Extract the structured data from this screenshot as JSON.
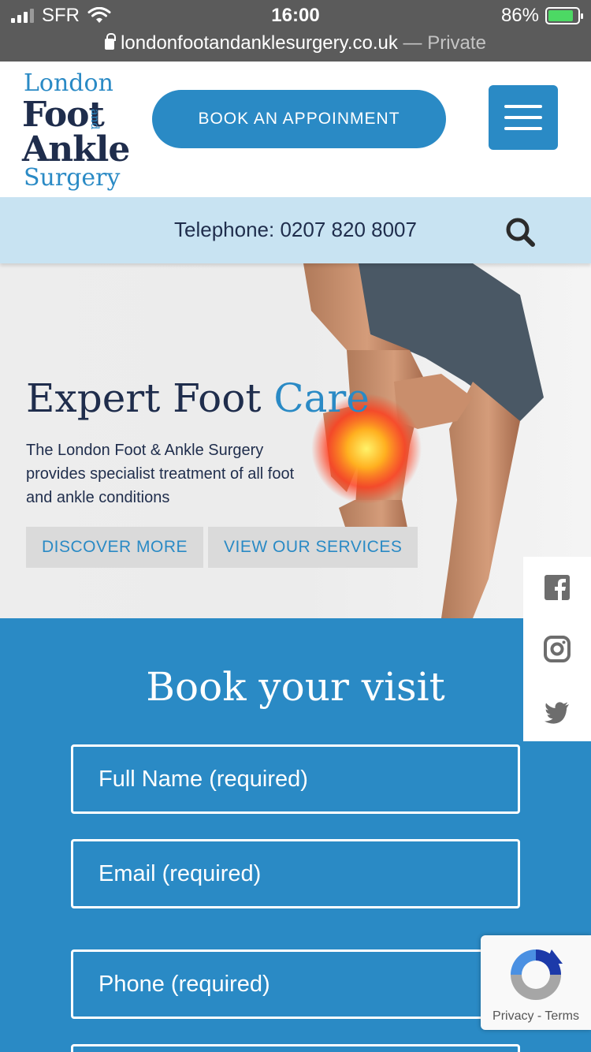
{
  "status_bar": {
    "carrier": "SFR",
    "time": "16:00",
    "battery_percent": "86%",
    "battery_level": 0.86,
    "battery_color": "#4cd964"
  },
  "url_bar": {
    "url": "londonfootandanklesurgery.co.uk",
    "mode": "— Private"
  },
  "logo": {
    "line1": "London",
    "line2": "Foot",
    "and": "and",
    "line3": "Ankle",
    "line4": "Surgery"
  },
  "header": {
    "book_label": "BOOK AN APPOINMENT",
    "menu_icon": "hamburger-icon"
  },
  "phone_bar": {
    "text": "Telephone: 0207 820 8007",
    "search_icon": "search-icon"
  },
  "hero": {
    "title_main": "Expert Foot ",
    "title_accent": "Care",
    "description": "The London Foot & Ankle Surgery provides specialist treatment of all foot and ankle conditions",
    "btn_discover": "DISCOVER MORE",
    "btn_services": "VIEW OUR SERVICES"
  },
  "booking": {
    "title": "Book your visit",
    "fields": {
      "full_name": "Full Name  (required)",
      "email": "Email (required)",
      "phone": "Phone (required)"
    }
  },
  "social": {
    "icons": [
      "facebook-icon",
      "instagram-icon",
      "twitter-icon"
    ]
  },
  "recaptcha": {
    "links": "Privacy - Terms"
  },
  "colors": {
    "brand_blue": "#2a8ac5",
    "navy": "#1f2d4c",
    "phone_bar_bg": "#c8e3f2",
    "status_bar_bg": "#5b5b5b"
  }
}
